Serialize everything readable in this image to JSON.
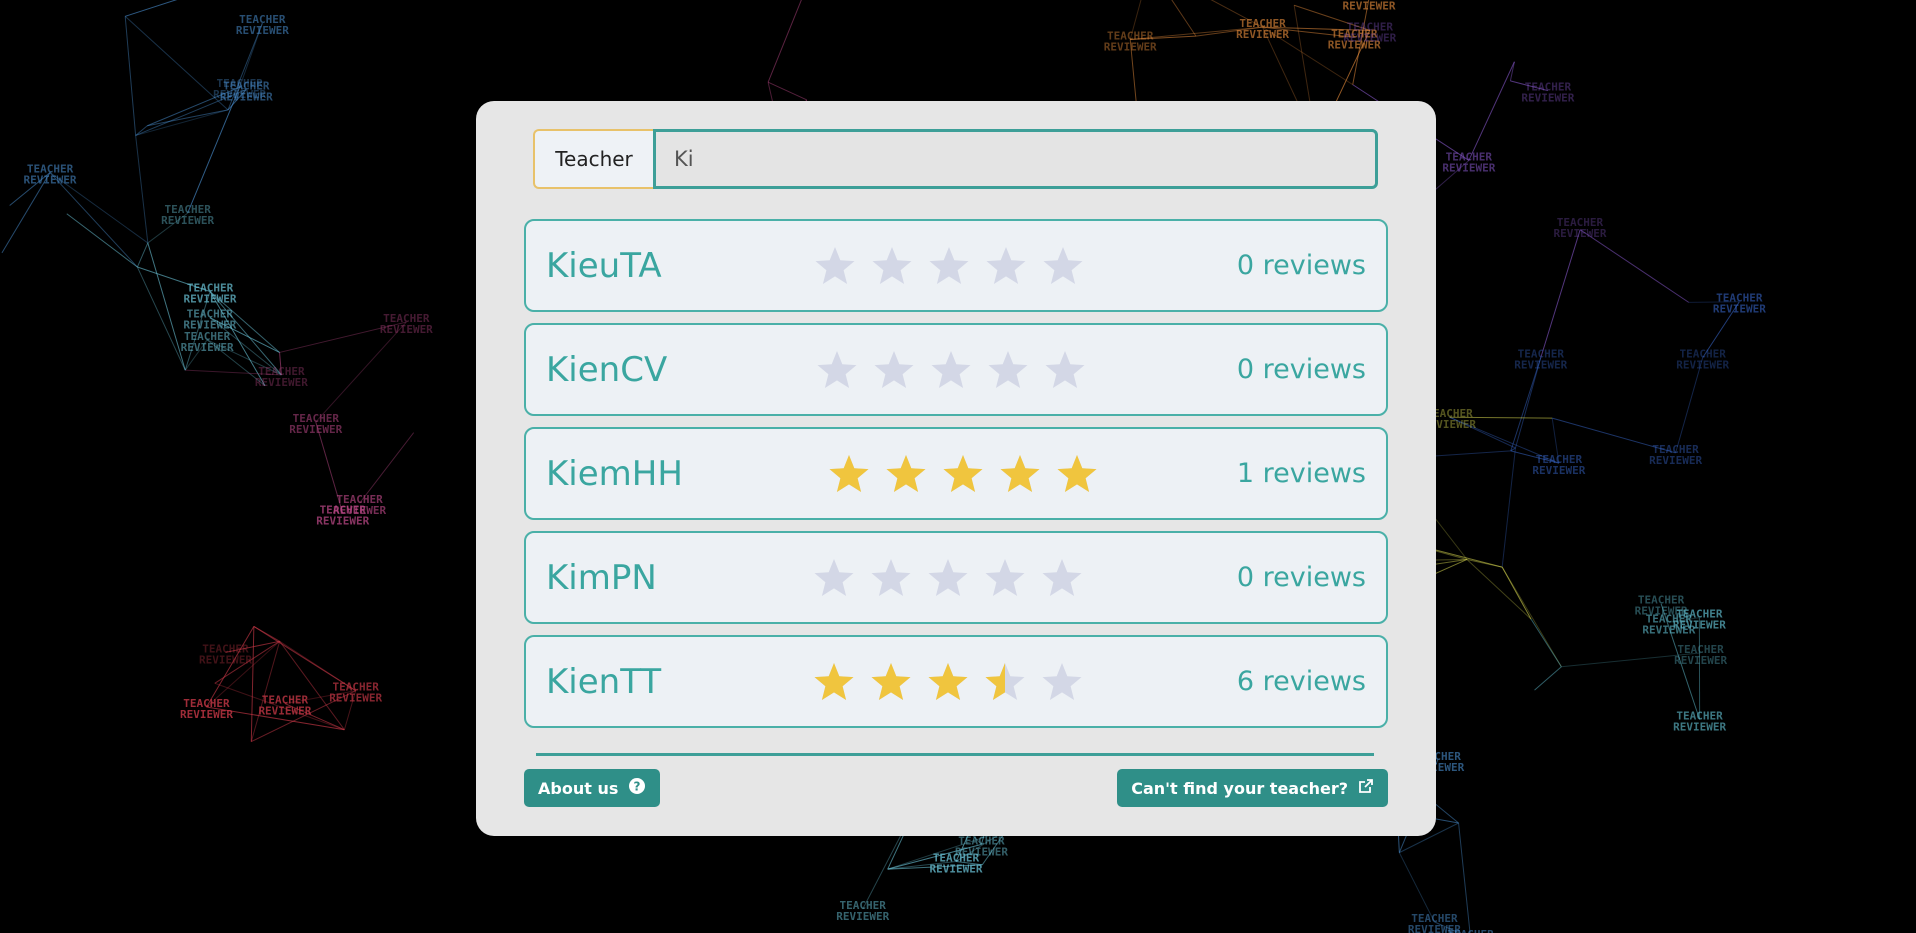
{
  "background": {
    "logo_line1": "TEACHER",
    "logo_line2": "REVIEWER"
  },
  "search": {
    "label": "Teacher",
    "value": "Ki"
  },
  "results": [
    {
      "name": "KieuTA",
      "rating": 0,
      "reviews": "0 reviews"
    },
    {
      "name": "KienCV",
      "rating": 0,
      "reviews": "0 reviews"
    },
    {
      "name": "KiemHH",
      "rating": 5,
      "reviews": "1 reviews"
    },
    {
      "name": "KimPN",
      "rating": 0,
      "reviews": "0 reviews"
    },
    {
      "name": "KienTT",
      "rating": 3.5,
      "reviews": "6 reviews"
    }
  ],
  "footer": {
    "about_label": "About us",
    "about_icon": "question-circle-icon",
    "cant_find_label": "Can't find your teacher?",
    "cant_find_icon": "external-link-icon"
  },
  "colors": {
    "accent": "#3d9f98",
    "star_filled": "#f0c53e",
    "star_empty": "#d3d7e6",
    "button": "#2f8f88"
  }
}
